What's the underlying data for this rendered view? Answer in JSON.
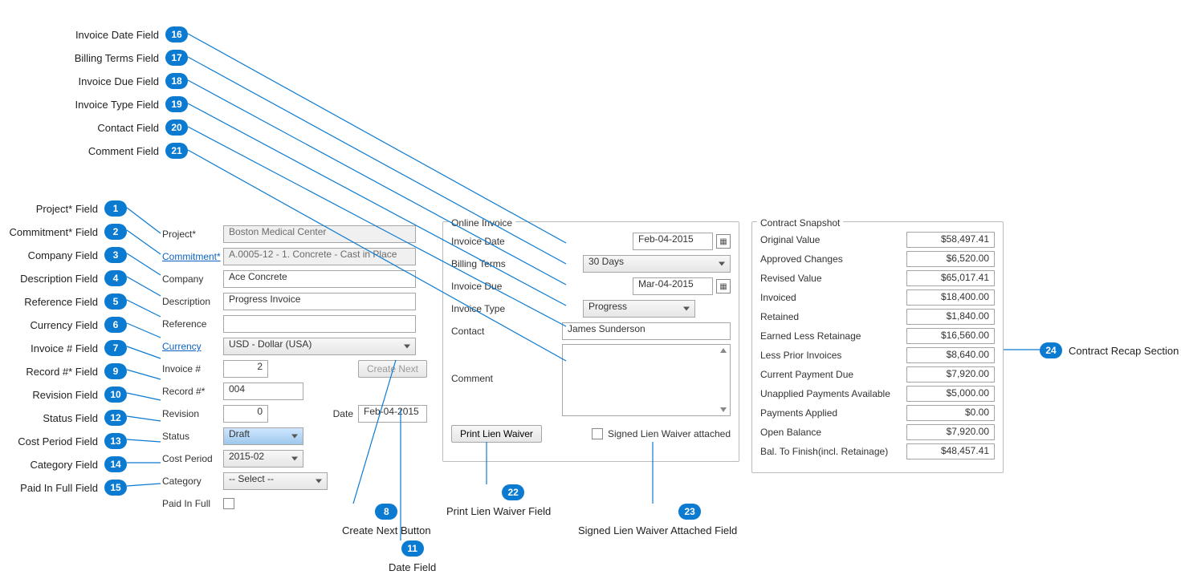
{
  "callouts": {
    "1": "Project* Field",
    "2": "Commitment* Field",
    "3": "Company Field",
    "4": "Description Field",
    "5": "Reference Field",
    "6": "Currency Field",
    "7": "Invoice # Field",
    "8": "Create Next Button",
    "9": "Record #* Field",
    "10": "Revision Field",
    "11": "Date Field",
    "12": "Status Field",
    "13": "Cost Period Field",
    "14": "Category Field",
    "15": "Paid In Full Field",
    "16": "Invoice Date Field",
    "17": "Billing Terms Field",
    "18": "Invoice Due Field",
    "19": "Invoice Type Field",
    "20": "Contact Field",
    "21": "Comment Field",
    "22": "Print Lien Waiver Field",
    "23": "Signed Lien Waiver Attached Field",
    "24": "Contract Recap Section"
  },
  "form": {
    "project_label": "Project*",
    "project_value": "Boston Medical Center",
    "commitment_label": "Commitment*",
    "commitment_value": "A.0005-12 - 1. Concrete - Cast in Place",
    "company_label": "Company",
    "company_value": "Ace Concrete",
    "description_label": "Description",
    "description_value": "Progress Invoice",
    "reference_label": "Reference",
    "reference_value": "",
    "currency_label": "Currency",
    "currency_value": "USD - Dollar (USA)",
    "invoice_no_label": "Invoice #",
    "invoice_no_value": "2",
    "create_next_label": "Create Next",
    "record_no_label": "Record #*",
    "record_no_value": "004",
    "revision_label": "Revision",
    "revision_value": "0",
    "date_label": "Date",
    "date_value": "Feb-04-2015",
    "status_label": "Status",
    "status_value": "Draft",
    "cost_period_label": "Cost Period",
    "cost_period_value": "2015-02",
    "category_label": "Category",
    "category_value": "-- Select --",
    "paid_label": "Paid In Full"
  },
  "online": {
    "legend": "Online Invoice",
    "invoice_date_label": "Invoice Date",
    "invoice_date_value": "Feb-04-2015",
    "billing_terms_label": "Billing Terms",
    "billing_terms_value": "30 Days",
    "invoice_due_label": "Invoice Due",
    "invoice_due_value": "Mar-04-2015",
    "invoice_type_label": "Invoice Type",
    "invoice_type_value": "Progress",
    "contact_label": "Contact",
    "contact_value": "James Sunderson",
    "comment_label": "Comment",
    "print_lien_label": "Print Lien Waiver",
    "signed_lien_label": "Signed Lien Waiver attached"
  },
  "snapshot": {
    "legend": "Contract Snapshot",
    "rows": [
      {
        "label": "Original Value",
        "value": "$58,497.41"
      },
      {
        "label": "Approved Changes",
        "value": "$6,520.00"
      },
      {
        "label": "Revised Value",
        "value": "$65,017.41"
      },
      {
        "label": "Invoiced",
        "value": "$18,400.00"
      },
      {
        "label": "Retained",
        "value": "$1,840.00"
      },
      {
        "label": "Earned Less Retainage",
        "value": "$16,560.00"
      },
      {
        "label": "Less Prior Invoices",
        "value": "$8,640.00"
      },
      {
        "label": "Current Payment Due",
        "value": "$7,920.00"
      },
      {
        "label": "Unapplied Payments Available",
        "value": "$5,000.00"
      },
      {
        "label": "Payments Applied",
        "value": "$0.00"
      },
      {
        "label": "Open Balance",
        "value": "$7,920.00"
      },
      {
        "label": "Bal. To Finish(incl. Retainage)",
        "value": "$48,457.41"
      }
    ]
  }
}
